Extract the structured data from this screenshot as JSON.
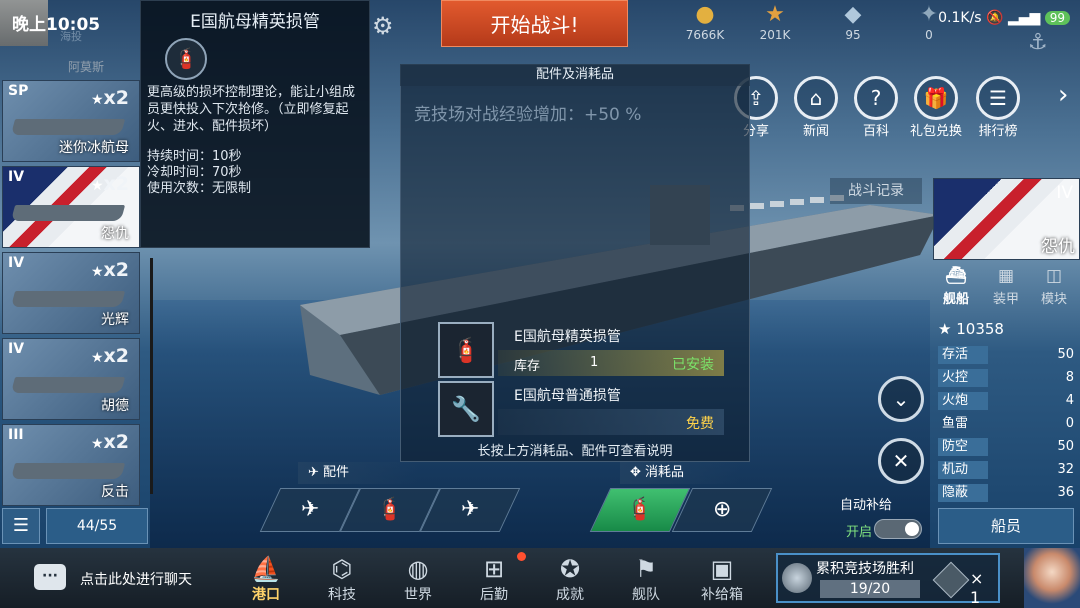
{
  "status": {
    "time": "晚上10:05",
    "network": "0.1K/s",
    "battery": "99"
  },
  "top": {
    "start_battle": "开始战斗!",
    "res1": "7666K",
    "res2": "201K",
    "res3": "95",
    "res4": "0",
    "faint_label": "海投"
  },
  "nav": [
    {
      "label": "分享"
    },
    {
      "label": "新闻"
    },
    {
      "label": "百科"
    },
    {
      "label": "礼包兑换"
    },
    {
      "label": "排行榜"
    }
  ],
  "tooltip": {
    "title": "E国航母精英损管",
    "desc": "更高级的损坏控制理论，能让小组成员更快投入下次抢修。（立即修复起火、进水、配件损坏）",
    "duration": "持续时间：10秒",
    "cooldown": "冷却时间：70秒",
    "uses": "使用次数：无限制",
    "hidden_label": "阿莫斯"
  },
  "ships": [
    {
      "tier": "SP",
      "count": "x2",
      "name": "迷你冰航母"
    },
    {
      "tier": "IV",
      "count": "x2",
      "name": "怨仇"
    },
    {
      "tier": "IV",
      "count": "x2",
      "name": "光辉"
    },
    {
      "tier": "IV",
      "count": "x2",
      "name": "胡德"
    },
    {
      "tier": "III",
      "count": "x2",
      "name": "反击"
    }
  ],
  "ship_count": "44/55",
  "panel": {
    "title": "配件及消耗品",
    "exp_bonus": "竞技场对战经验增加：+50 %",
    "hint": "长按上方消耗品、配件可查看说明",
    "items": [
      {
        "name": "E国航母精英损管",
        "stock_label": "库存",
        "stock": "1",
        "status": "已安装",
        "status_color": "#7be36a"
      },
      {
        "name": "E国航母普通损管",
        "stock_label": "",
        "stock": "",
        "status": "免费",
        "status_color": "#ffd34a"
      }
    ]
  },
  "equip": {
    "parts_label": "配件",
    "consumables_label": "消耗品"
  },
  "right": {
    "tier": "IV",
    "ship_name": "怨仇",
    "battle_record": "战斗记录",
    "tabs": [
      {
        "label": "舰船"
      },
      {
        "label": "装甲"
      },
      {
        "label": "模块"
      }
    ],
    "power": "10358",
    "stats": [
      {
        "label": "存活",
        "value": "50"
      },
      {
        "label": "火控",
        "value": "8"
      },
      {
        "label": "火炮",
        "value": "4"
      },
      {
        "label": "鱼雷",
        "value": "0"
      },
      {
        "label": "防空",
        "value": "50"
      },
      {
        "label": "机动",
        "value": "32"
      },
      {
        "label": "隐蔽",
        "value": "36"
      }
    ],
    "auto_supply": "自动补给",
    "toggle": "开启",
    "crew": "船员"
  },
  "bottom": {
    "chat": "点击此处进行聊天",
    "nav": [
      {
        "label": "港口"
      },
      {
        "label": "科技"
      },
      {
        "label": "世界"
      },
      {
        "label": "后勤"
      },
      {
        "label": "成就"
      },
      {
        "label": "舰队"
      },
      {
        "label": "补给箱"
      }
    ],
    "arena_title": "累积竞技场胜利",
    "arena_progress": "19/20",
    "arena_reward": "× 1"
  }
}
